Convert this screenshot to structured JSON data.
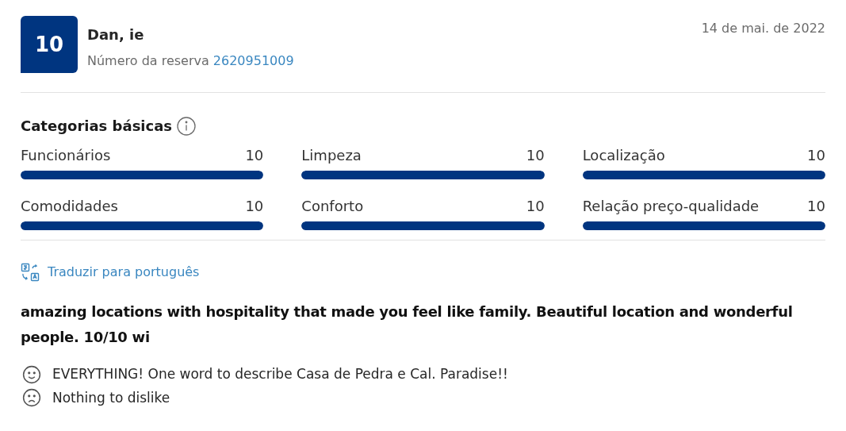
{
  "review": {
    "score": "10",
    "reviewer": "Dan, ie",
    "booking_label": "Número da reserva",
    "booking_number": "2620951009",
    "date": "14 de mai. de 2022"
  },
  "categories": {
    "title": "Categorias básicas",
    "items": [
      {
        "label": "Funcionários",
        "score": "10",
        "level": 1
      },
      {
        "label": "Limpeza",
        "score": "10",
        "level": 1
      },
      {
        "label": "Localização",
        "score": "10",
        "level": 1
      },
      {
        "label": "Comodidades",
        "score": "10",
        "level": 1
      },
      {
        "label": "Conforto",
        "score": "10",
        "level": 1
      },
      {
        "label": "Relação preço-qualidade",
        "score": "10",
        "level": 1
      }
    ]
  },
  "translate_link": "Traduzir para português",
  "headline": "amazing locations with hospitality that made you feel like family. Beautiful location and wonderful people. 10/10 wi",
  "comments": [
    {
      "kind": "positive",
      "text": "EVERYTHING! One word to describe Casa de Pedra e Cal. Paradise!!"
    },
    {
      "kind": "negative",
      "text": "Nothing to dislike"
    }
  ]
}
